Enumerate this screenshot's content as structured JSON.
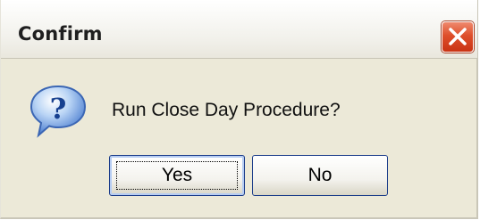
{
  "window": {
    "title": "Confirm",
    "close_icon": "close-icon"
  },
  "dialog": {
    "icon": "question-icon",
    "message": "Run Close Day Procedure?"
  },
  "buttons": {
    "yes_label": "Yes",
    "no_label": "No"
  },
  "colors": {
    "dialog_background": "#ece9d8",
    "close_button": "#de4f2b",
    "button_border": "#1c3d8a",
    "question_icon": "#2f6fd0"
  }
}
